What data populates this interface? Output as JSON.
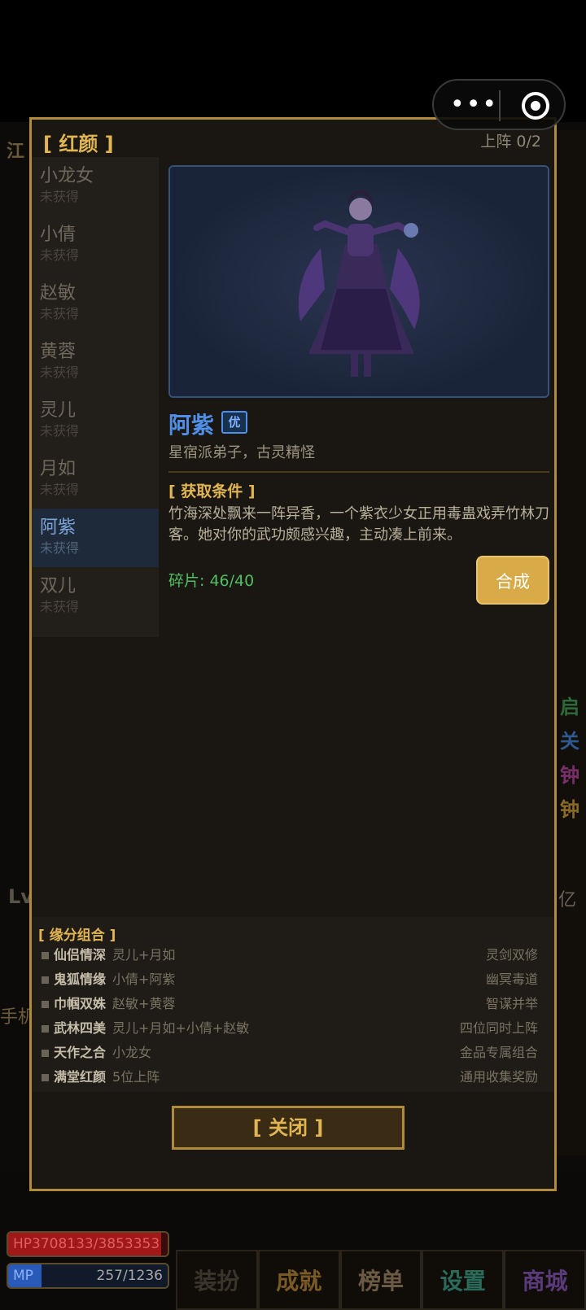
{
  "menu_capsule": {
    "more": "•••"
  },
  "background": {
    "left_labels": [
      "江",
      "Lv",
      "手机"
    ],
    "right_labels": [
      "启",
      "关",
      "钟",
      "钟"
    ],
    "right_colors": [
      "#3a8a4a",
      "#3a6aa8",
      "#a03a8a",
      "#b08a30"
    ],
    "billion_label": "亿",
    "hp_text": "HP3708133/3853353",
    "hp_fraction": 0.96,
    "mp_label": "MP",
    "mp_value": "257/1236",
    "mp_fraction": 0.208,
    "bottom_nav": [
      {
        "label": "装扮",
        "color": "#3a352b"
      },
      {
        "label": "成就",
        "color": "#7a5a24"
      },
      {
        "label": "榜单",
        "color": "#6a5a44"
      },
      {
        "label": "设置",
        "color": "#2a6a5a"
      },
      {
        "label": "商城",
        "color": "#5a3a7a"
      }
    ]
  },
  "modal": {
    "title": "[ 红颜 ]",
    "deployed": "上阵 0/2",
    "list": [
      {
        "name": "小龙女",
        "status": "未获得"
      },
      {
        "name": "小倩",
        "status": "未获得"
      },
      {
        "name": "赵敏",
        "status": "未获得"
      },
      {
        "name": "黄蓉",
        "status": "未获得"
      },
      {
        "name": "灵儿",
        "status": "未获得"
      },
      {
        "name": "月如",
        "status": "未获得"
      },
      {
        "name": "阿紫",
        "status": "未获得"
      },
      {
        "name": "双儿",
        "status": "未获得"
      }
    ],
    "selected_index": 6,
    "hero": {
      "name": "阿紫",
      "grade": "优",
      "description": "星宿派弟子，古灵精怪",
      "condition_title": "[ 获取条件 ]",
      "condition_text": "竹海深处飘来一阵异香，一个紫衣少女正用毒蛊戏弄竹林刀客。她对你的武功颇感兴趣，主动凑上前来。",
      "shards": "碎片: 46/40",
      "synth_button": "合成"
    },
    "fate": {
      "title": "[ 缘分组合 ]",
      "items": [
        {
          "name": "仙侣情深",
          "members": "灵儿+月如",
          "effect": "灵剑双修"
        },
        {
          "name": "鬼狐情缘",
          "members": "小倩+阿紫",
          "effect": "幽冥毒道"
        },
        {
          "name": "巾帼双姝",
          "members": "赵敏+黄蓉",
          "effect": "智谋并举"
        },
        {
          "name": "武林四美",
          "members": "灵儿+月如+小倩+赵敏",
          "effect": "四位同时上阵"
        },
        {
          "name": "天作之合",
          "members": "小龙女",
          "effect": "金品专属组合"
        },
        {
          "name": "满堂红颜",
          "members": "5位上阵",
          "effect": "通用收集奖励"
        }
      ]
    },
    "close_button": "[ 关闭 ]"
  }
}
